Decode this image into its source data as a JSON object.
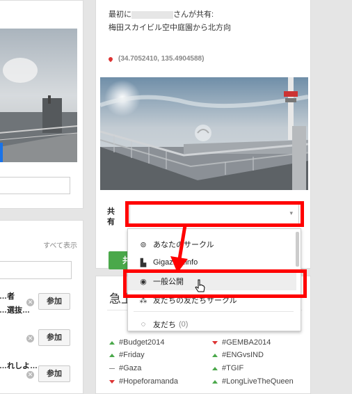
{
  "post": {
    "shared_prefix": "最初に",
    "shared_suffix": "さんが共有:",
    "location_title": "梅田スカイビル空中庭園から北方向",
    "coords": "(34.7052410, 135.4904588)"
  },
  "share": {
    "label_line1": "共",
    "label_line2": "有",
    "select_value": ""
  },
  "share_button_partial": "共",
  "dropdown": {
    "items": [
      {
        "icon": "circles-icon",
        "label": "あなたのサークル",
        "count": ""
      },
      {
        "icon": "building-icon",
        "label": "Gigazine.info",
        "count": ""
      },
      {
        "icon": "globe-icon",
        "label": "一般公開",
        "count": ""
      },
      {
        "icon": "extended-circles-icon",
        "label": "友だちの友だちサークル",
        "count": ""
      },
      {
        "icon": "circle-icon",
        "label": "友だち",
        "count": "(0)"
      }
    ]
  },
  "communities": {
    "show_all": "すべて表示",
    "join_label": "参加",
    "items": [
      {
        "name": "…者"
      },
      {
        "name": "…選抜…"
      },
      {
        "name": "…れしよ…"
      }
    ]
  },
  "trending": {
    "title_partial": "急上",
    "left": [
      {
        "tag": "#Budget2014",
        "trend": "up"
      },
      {
        "tag": "#Friday",
        "trend": "up"
      },
      {
        "tag": "#Gaza",
        "trend": "flat"
      },
      {
        "tag": "#Hopeforamanda",
        "trend": "down"
      }
    ],
    "right": [
      {
        "tag": "#GEMBA2014",
        "trend": "down"
      },
      {
        "tag": "#ENGvsIND",
        "trend": "up"
      },
      {
        "tag": "#TGIF",
        "trend": "up"
      },
      {
        "tag": "#LongLiveTheQueen",
        "trend": "up"
      }
    ]
  },
  "colors": {
    "highlight": "#ff0000",
    "share_green": "#4aa84a",
    "page_bg": "#e5e5e5"
  }
}
